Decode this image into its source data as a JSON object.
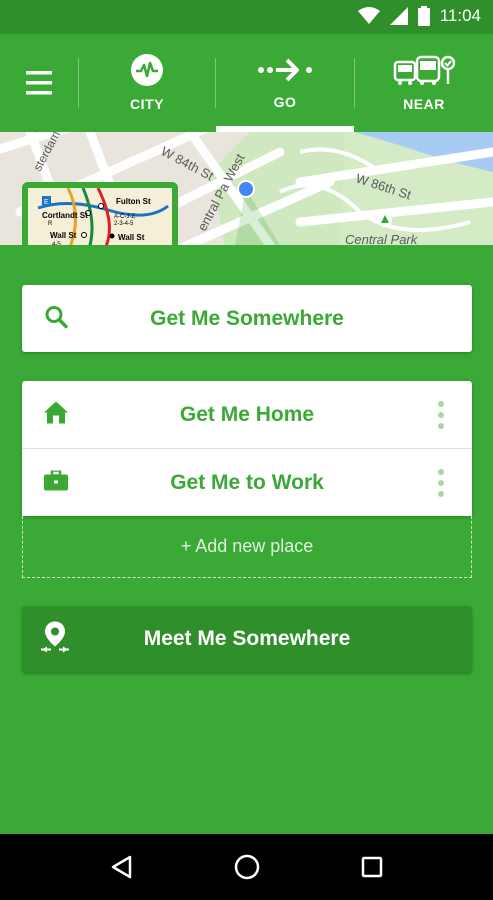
{
  "status_bar": {
    "time": "11:04",
    "icons": [
      "wifi-icon",
      "signal-icon",
      "battery-icon"
    ]
  },
  "toolbar": {
    "menu_icon": "hamburger-menu-icon",
    "tabs": [
      {
        "label": "CITY",
        "icon": "pulse-icon",
        "active": false
      },
      {
        "label": "GO",
        "icon": "route-arrow-icon",
        "active": true
      },
      {
        "label": "NEAR",
        "icon": "transit-vehicles-icon",
        "active": false
      }
    ]
  },
  "map": {
    "street_labels": [
      "W 84th St",
      "W 86th St",
      "entral Pa West",
      "Central Park",
      "sterdam A"
    ],
    "subway_thumbnail": {
      "stations": [
        "Fulton St",
        "Cortlandt St",
        "Wall St",
        "Wall St"
      ],
      "line_labels": [
        "A-C-J-Z",
        "2-3-4-5",
        "4-5",
        "R",
        "E"
      ]
    }
  },
  "search_card": {
    "label": "Get Me Somewhere",
    "icon": "search-icon"
  },
  "places": [
    {
      "label": "Get Me Home",
      "icon": "home-icon"
    },
    {
      "label": "Get Me to Work",
      "icon": "briefcase-icon"
    }
  ],
  "add_place_label": "+ Add new place",
  "meet": {
    "label": "Meet Me Somewhere",
    "icon": "meet-location-icon"
  },
  "nav_bar": {
    "icons": [
      "back-icon",
      "home-circle-icon",
      "recents-icon"
    ]
  },
  "colors": {
    "primary_green": "#3aa935",
    "dark_green": "#2f8f2a",
    "light_green": "#a8d8a2",
    "white": "#ffffff"
  }
}
